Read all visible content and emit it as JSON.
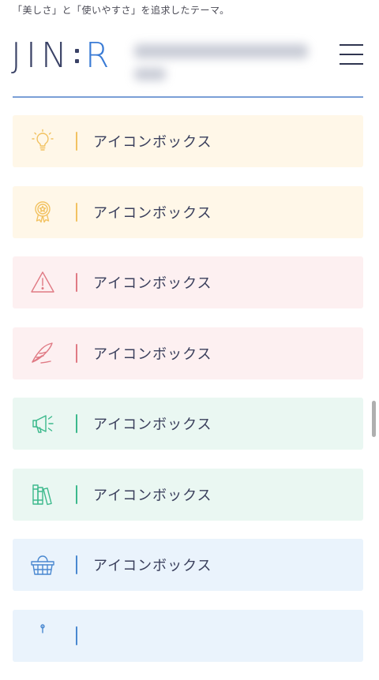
{
  "header": {
    "tagline": "「美しさ」と「使いやすさ」を追求したテーマ。",
    "logo_main": "JIN",
    "logo_accent": "R"
  },
  "colors": {
    "accent": "#3a7bd5",
    "divider": "#7a9fd6"
  },
  "boxes": [
    {
      "label": "アイコンボックス",
      "icon": "lightbulb-icon",
      "bg": "#fff7e8",
      "color": "#f2c261"
    },
    {
      "label": "アイコンボックス",
      "icon": "award-medal-icon",
      "bg": "#fff7e8",
      "color": "#f2c261"
    },
    {
      "label": "アイコンボックス",
      "icon": "warning-icon",
      "bg": "#fdf0f1",
      "color": "#e07a84"
    },
    {
      "label": "アイコンボックス",
      "icon": "feather-icon",
      "bg": "#fdf0f1",
      "color": "#e07a84"
    },
    {
      "label": "アイコンボックス",
      "icon": "megaphone-icon",
      "bg": "#eaf7f2",
      "color": "#3cb98c"
    },
    {
      "label": "アイコンボックス",
      "icon": "books-icon",
      "bg": "#eaf7f2",
      "color": "#3cb98c"
    },
    {
      "label": "アイコンボックス",
      "icon": "basket-icon",
      "bg": "#eaf3fc",
      "color": "#4a88d0"
    },
    {
      "label": "",
      "icon": "partial-icon",
      "bg": "#eaf3fc",
      "color": "#4a88d0"
    }
  ]
}
